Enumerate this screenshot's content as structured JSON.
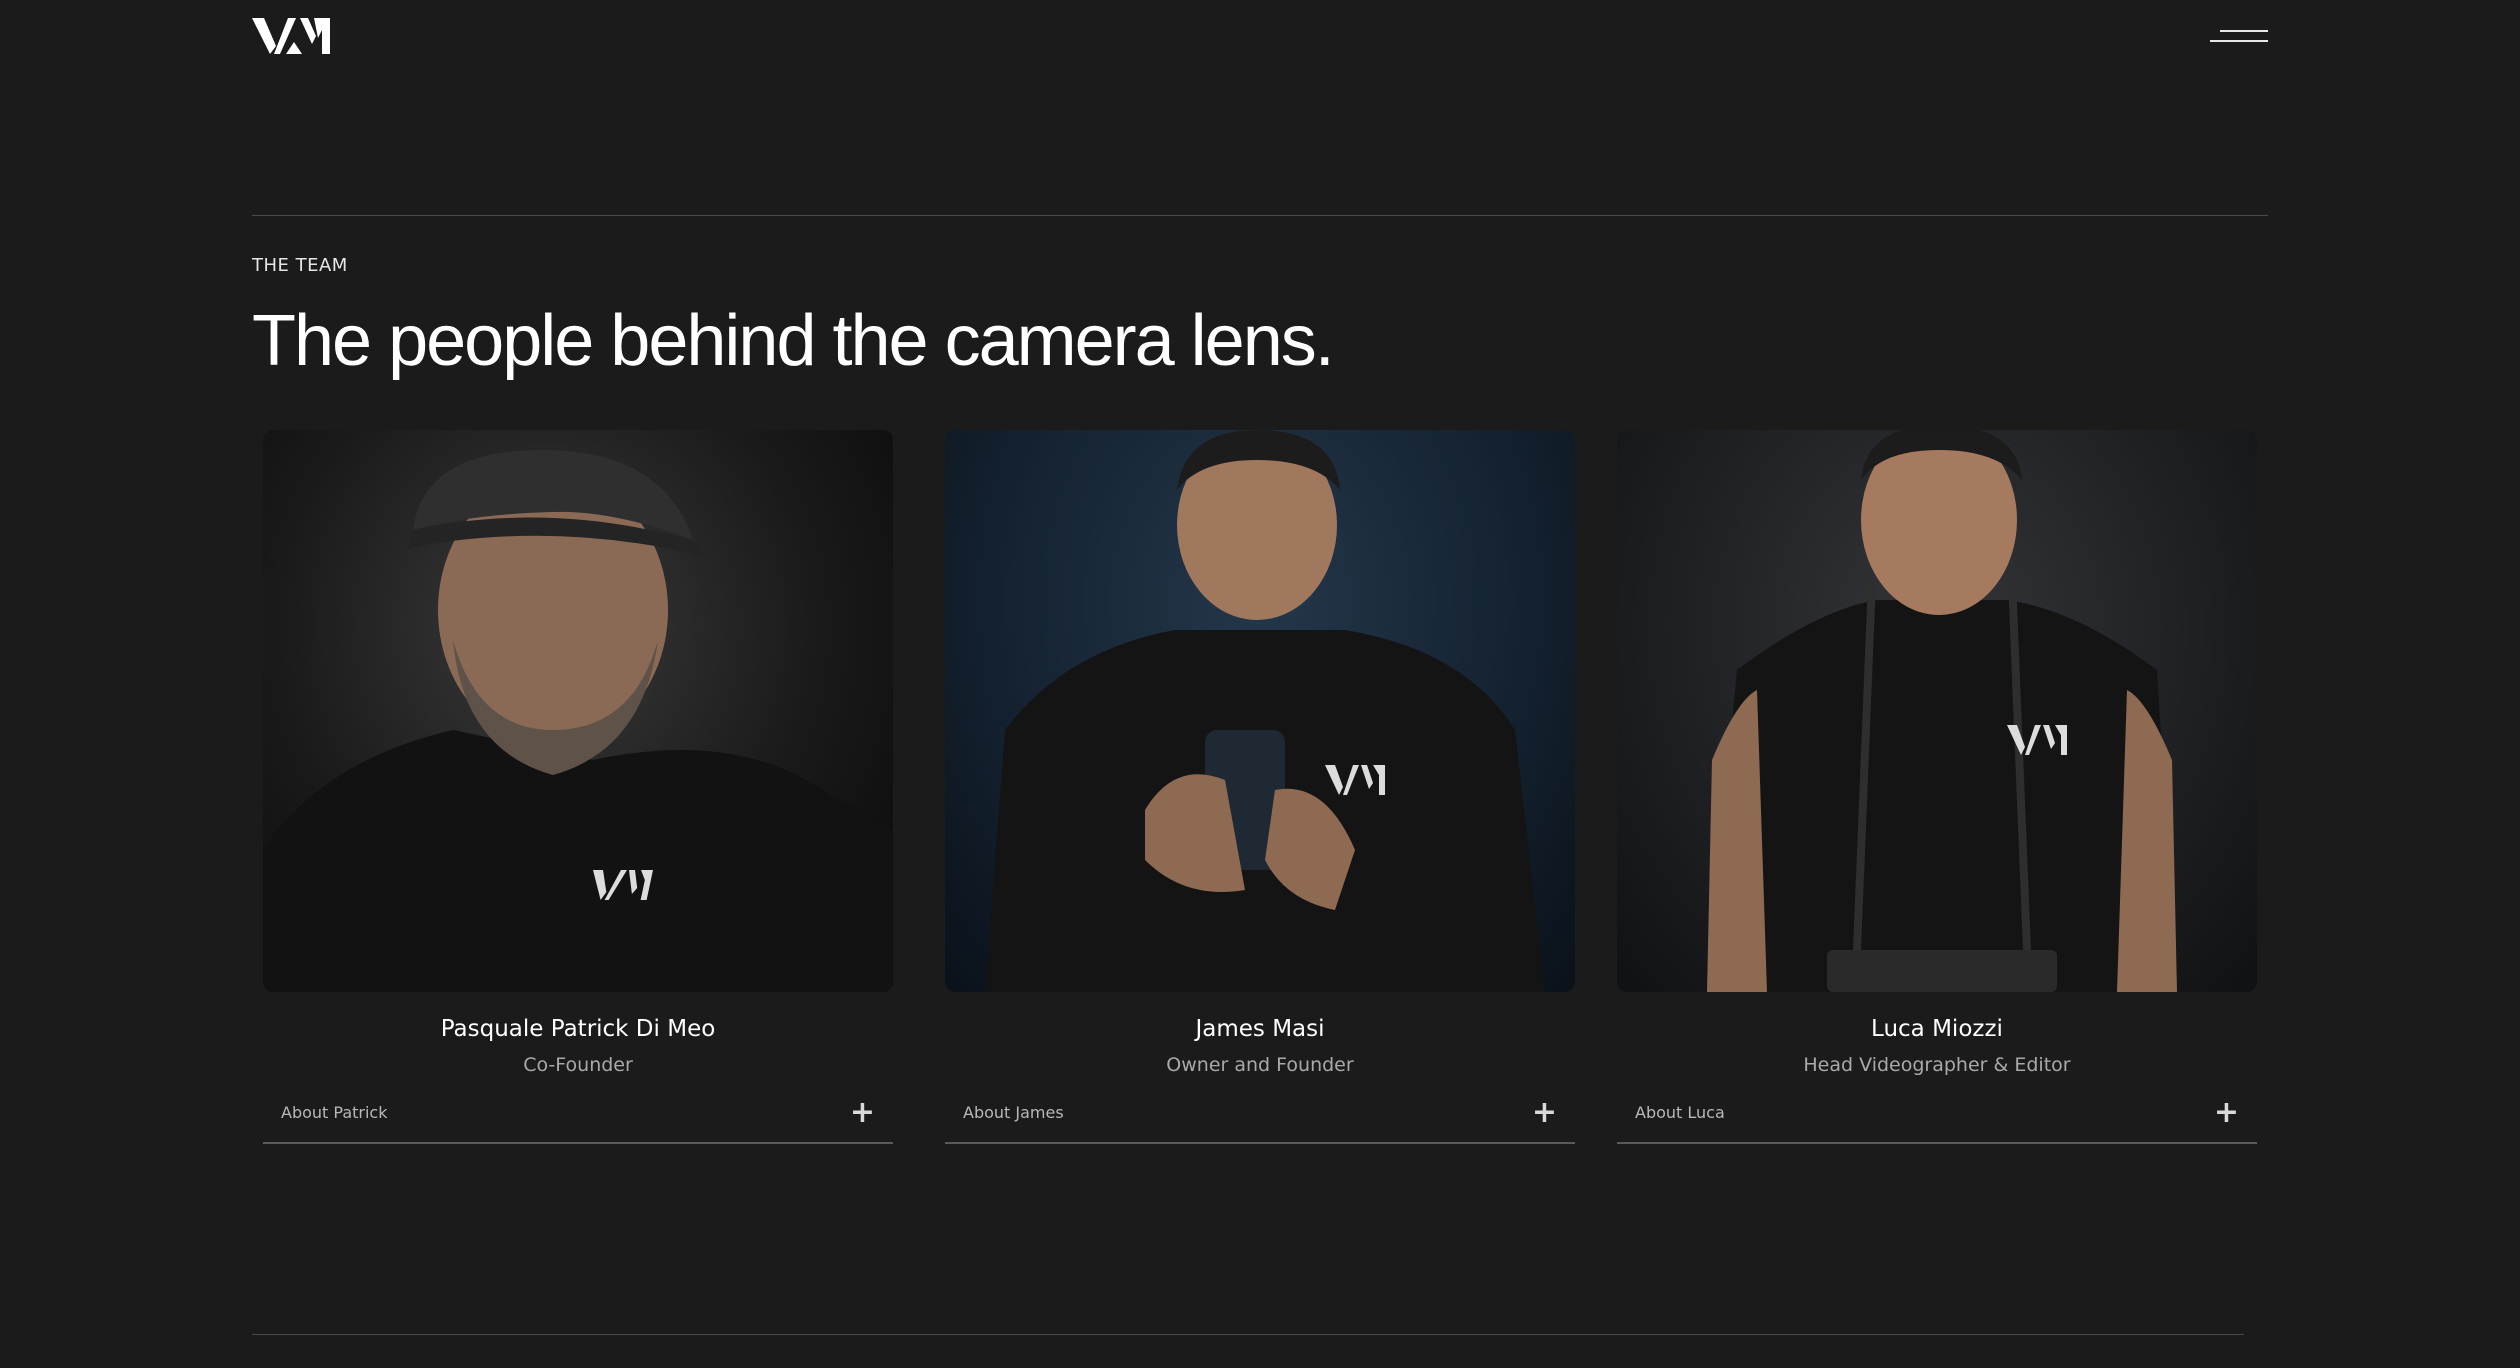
{
  "header": {
    "logo_text": "VM",
    "menu_icon": "hamburger-menu-icon"
  },
  "section": {
    "eyebrow": "THE TEAM",
    "headline": "The people behind the camera lens."
  },
  "team": [
    {
      "name": "Pasquale Patrick Di Meo",
      "role": "Co-Founder",
      "about_label": "About Patrick",
      "expand_icon": "plus-icon"
    },
    {
      "name": "James Masi",
      "role": "Owner and Founder",
      "about_label": "About James",
      "expand_icon": "plus-icon"
    },
    {
      "name": "Luca Miozzi",
      "role": "Head Videographer & Editor",
      "about_label": "About Luca",
      "expand_icon": "plus-icon"
    }
  ],
  "colors": {
    "background": "#1b1b1b",
    "text": "#ffffff",
    "muted_text": "#a9a9a9",
    "divider": "#4a4a4a"
  }
}
